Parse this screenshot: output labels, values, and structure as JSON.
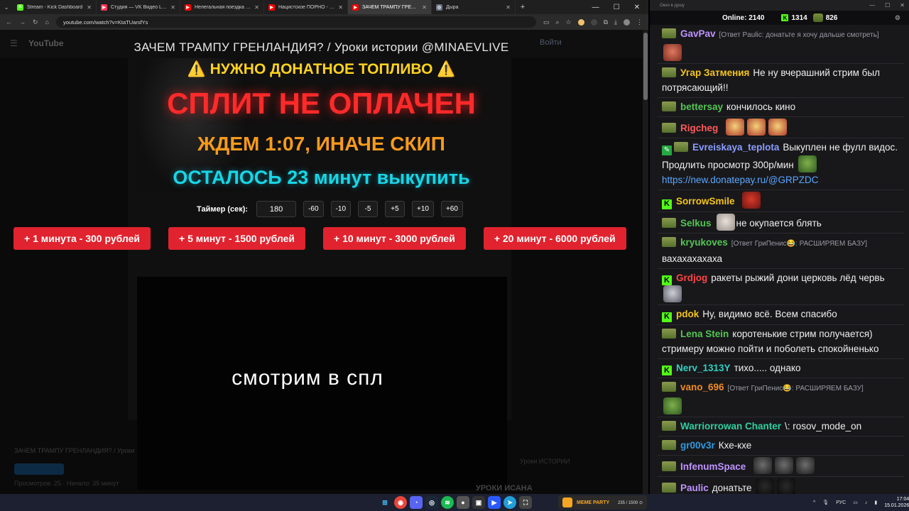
{
  "browser": {
    "tabs": [
      {
        "title": "Stream - Kick Dashboard",
        "favicon_color": "#53fc18",
        "favicon_glyph": "K",
        "active": false
      },
      {
        "title": "Студия — VK Видео Live",
        "favicon_color": "#ff3355",
        "favicon_glyph": "▶",
        "active": false
      },
      {
        "title": "Нелегальная поездка в Сирию",
        "favicon_color": "#ff0000",
        "favicon_glyph": "▶",
        "active": false
      },
      {
        "title": "Нацистское ПОРНО - обзор ф",
        "favicon_color": "#ff0000",
        "favicon_glyph": "▶",
        "active": false
      },
      {
        "title": "ЗАЧЕМ ТРАМПУ ГРЕНЛАНДИЯ",
        "favicon_color": "#ff0000",
        "favicon_glyph": "▶",
        "active": true
      },
      {
        "title": "Дыра",
        "favicon_color": "#6b7280",
        "favicon_glyph": "◎",
        "active": false
      }
    ],
    "url": "youtube.com/watch?v=KtaTUarsfYs",
    "window_controls": [
      "—",
      "☐",
      "✕"
    ]
  },
  "page": {
    "youtube_logo": "YouTube",
    "signin_label": "Войти",
    "title": "ЗАЧЕМ ТРАМПУ ГРЕНЛАНДИЯ? / Уроки истории @MINAEVLIVE",
    "fuel_heading": "⚠️ НУЖНО ДОНАТНОЕ ТОПЛИВО ⚠️",
    "split_heading": "СПЛИТ НЕ ОПЛАЧЕН",
    "wait_heading": "ЖДЕМ 1:07, ИНАЧЕ СКИП",
    "left_heading": "ОСТАЛОСЬ 23 минут выкупить",
    "timer_label": "Таймер (сек):",
    "timer_value": "180",
    "timer_buttons": [
      "-60",
      "-10",
      "-5",
      "+5",
      "+10",
      "+60"
    ],
    "buy_buttons": [
      "+ 1 минута - 300 рублей",
      "+ 5 минут - 1500 рублей",
      "+ 10 минут - 3000 рублей",
      "+ 20 минут - 6000 рублей"
    ],
    "caption": "смотрим в спл",
    "below_title": "ЗАЧЕМ ТРАМПУ ГРЕНЛАНДИЯ? / Уроки",
    "below_views": "Просмотров: 25 · Начало: 35 минут",
    "below_side": "Уроки ИСТОРИИ",
    "below_next": "УРОКИ ИСАНА"
  },
  "chat": {
    "window_title": "Окно в душу",
    "online_label": "Online:",
    "online_count": "2140",
    "kick_count": "1314",
    "youtube_count": "826",
    "messages": [
      {
        "badge": "frog",
        "nick": "GavPav",
        "color": "#bf94ff",
        "reply": "[Ответ Paulic: донатьте я хочу дальше смотреть]",
        "text": "",
        "emotes": [
          "e-face"
        ],
        "emote_block": true
      },
      {
        "badge": "frog",
        "nick": "Угар Затмения",
        "color": "#f5c518",
        "reply": "",
        "text": "Не ну вчерашний стрим был потрясающий!!",
        "emotes": []
      },
      {
        "badge": "frog",
        "nick": "bettersay",
        "color": "#53c653",
        "reply": "",
        "text": "кончилось кино",
        "emotes": []
      },
      {
        "badge": "frog",
        "nick": "Rigcheg",
        "color": "#ff5a5a",
        "reply": "",
        "text": "",
        "emotes": [
          "e-rig",
          "e-rig",
          "e-rig"
        ]
      },
      {
        "badge": "mod-frog",
        "nick": "Evreiskaya_teplota",
        "color": "#8a9dff",
        "reply": "",
        "text": "Выкуплен не фулл видос. Продлить просмотр 300р/мин",
        "emotes": [
          "e-pep"
        ],
        "link": "https://new.donatepay.ru/@GRPZDC"
      },
      {
        "badge": "kick",
        "nick": "SorrowSmile",
        "color": "#f5c518",
        "reply": "",
        "text": "",
        "emotes": [
          "e-red"
        ]
      },
      {
        "badge": "frog",
        "nick": "Selkus",
        "color": "#53c653",
        "reply": "",
        "text": "не окупается блять",
        "emotes": [
          "e-cat"
        ],
        "emote_first": true
      },
      {
        "badge": "frog",
        "nick": "kryukoves",
        "color": "#53c653",
        "reply": "[Ответ ГриПенис😂: РАСШИРЯЕМ БАЗУ]",
        "text": "вахахахахаха",
        "emotes": [],
        "text_block": true
      },
      {
        "badge": "kick",
        "nick": "Grdjog",
        "color": "#ff4444",
        "reply": "",
        "text": "ракеты рыжий дони церковь лёд червь",
        "emotes": [
          "e-guy"
        ]
      },
      {
        "badge": "kick",
        "nick": "pdok",
        "color": "#f5c518",
        "reply": "",
        "text": "Ну, видимо всё. Всем спасибо",
        "emotes": []
      },
      {
        "badge": "frog",
        "nick": "Lena Stein",
        "color": "#53c653",
        "reply": "",
        "text": "коротенькие стрим получается) стримеру можно пойти и поболеть спокойненько",
        "emotes": []
      },
      {
        "badge": "kick",
        "nick": "Nerv_1313Y",
        "color": "#2fd0c0",
        "reply": "",
        "text": "тихо..... однако",
        "emotes": []
      },
      {
        "badge": "frog",
        "nick": "vano_696",
        "color": "#f08a24",
        "reply": "[Ответ ГриПенис😂: РАСШИРЯЕМ БАЗУ]",
        "text": "",
        "emotes": [
          "e-pep"
        ],
        "emote_block": true
      },
      {
        "badge": "frog",
        "nick": "Warriorrowan Chanter",
        "color": "#2fd0a0",
        "reply": "",
        "text": "\\: rosov_mode_on",
        "emotes": []
      },
      {
        "badge": "frog",
        "nick": "gr00v3r",
        "color": "#2f9be0",
        "reply": "",
        "text": "Кхе-кхе",
        "emotes": []
      },
      {
        "badge": "frog",
        "nick": "InfenumSpace",
        "color": "#bf94ff",
        "reply": "",
        "text": "",
        "emotes": [
          "e-feed",
          "e-feed",
          "e-feed"
        ]
      },
      {
        "badge": "frog",
        "nick": "Paulic",
        "color": "#bf94ff",
        "reply": "",
        "text": "донатьте",
        "emotes": [
          "e-spin",
          "e-spin"
        ],
        "emote_wrap": true
      }
    ]
  },
  "taskbar": {
    "media_title": "MEME PARTY",
    "media_progress": "235 / 1500 ⊙",
    "lang": "РУС",
    "time": "17:04",
    "date": "15.01.2026"
  }
}
